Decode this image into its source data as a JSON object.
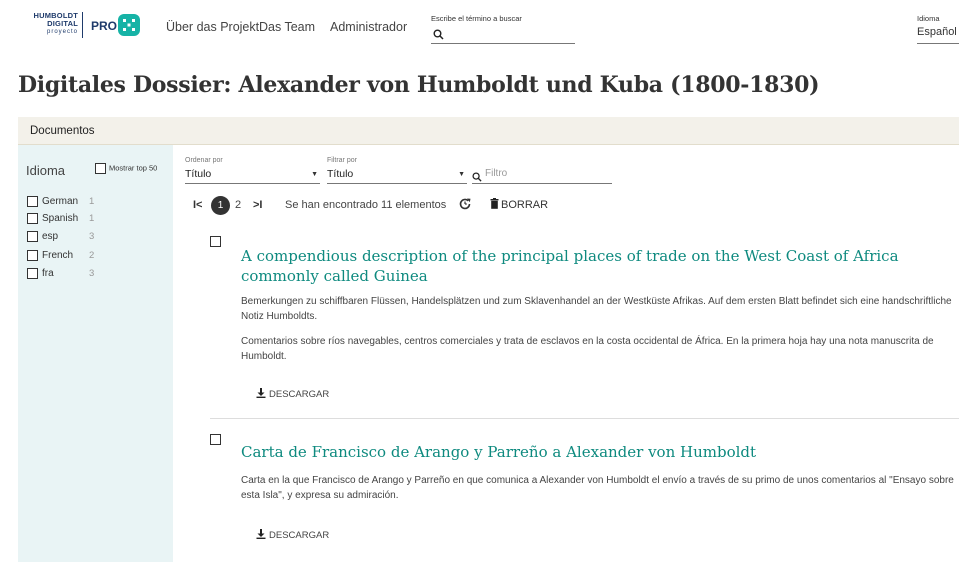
{
  "logo": {
    "line1": "HUMBOLDT",
    "line2": "DIGITAL",
    "line3": "proyecto",
    "pro": "PRO"
  },
  "nav": {
    "items": [
      "Über das Projekt",
      "Das Team",
      "Administrador"
    ]
  },
  "search": {
    "label": "Escribe el término a buscar",
    "value": ""
  },
  "language": {
    "label": "Idioma",
    "value": "Español"
  },
  "page": {
    "title": "Digitales Dossier: Alexander von Humboldt und Kuba (1800-1830)"
  },
  "section": {
    "title": "Documentos"
  },
  "facet": {
    "title": "Idioma",
    "top50_label": "Mostrar top 50",
    "items": [
      {
        "label": "German",
        "count": "1"
      },
      {
        "label": "Spanish",
        "count": "1"
      },
      {
        "label": "esp",
        "count": "3"
      },
      {
        "label": "French",
        "count": "2"
      },
      {
        "label": "fra",
        "count": "3"
      }
    ]
  },
  "controls": {
    "sort_label": "Ordenar por",
    "sort_value": "Título",
    "filter_label": "Filtrar por",
    "filter_value": "Título",
    "filter_placeholder": "Filtro"
  },
  "pagination": {
    "first": "I<",
    "current": "1",
    "next": "2",
    "last": ">I",
    "found_text": "Se han encontrado 11 elementos",
    "clear_label": "BORRAR"
  },
  "results": [
    {
      "title": "A compendious description of the principal places of trade on the West Coast of Africa commonly called Guinea",
      "desc_de": "Bemerkungen zu schiffbaren Flüssen, Handelsplätzen und zum Sklavenhandel an der Westküste Afrikas. Auf dem ersten Blatt befindet sich eine handschriftliche Notiz Humboldts.",
      "desc_es": "Comentarios sobre ríos navegables, centros comerciales y trata de esclavos en la costa occidental de África. En la primera hoja hay una nota manuscrita de Humboldt.",
      "download_label": "DESCARGAR"
    },
    {
      "title": "Carta de Francisco de Arango y Parreño a Alexander von Humboldt",
      "desc_es": "Carta en la que Francisco de Arango y Parreño en que comunica a Alexander von Humboldt el envío a través de su primo de unos comentarios al \"Ensayo sobre esta Isla\", y expresa su admiración.",
      "download_label": "DESCARGAR"
    }
  ],
  "colors": {
    "accent": "#0e8a7f",
    "logo_teal": "#16b3a6",
    "sidebar_bg": "#e9f4f5",
    "section_bg": "#f3f1ea"
  }
}
